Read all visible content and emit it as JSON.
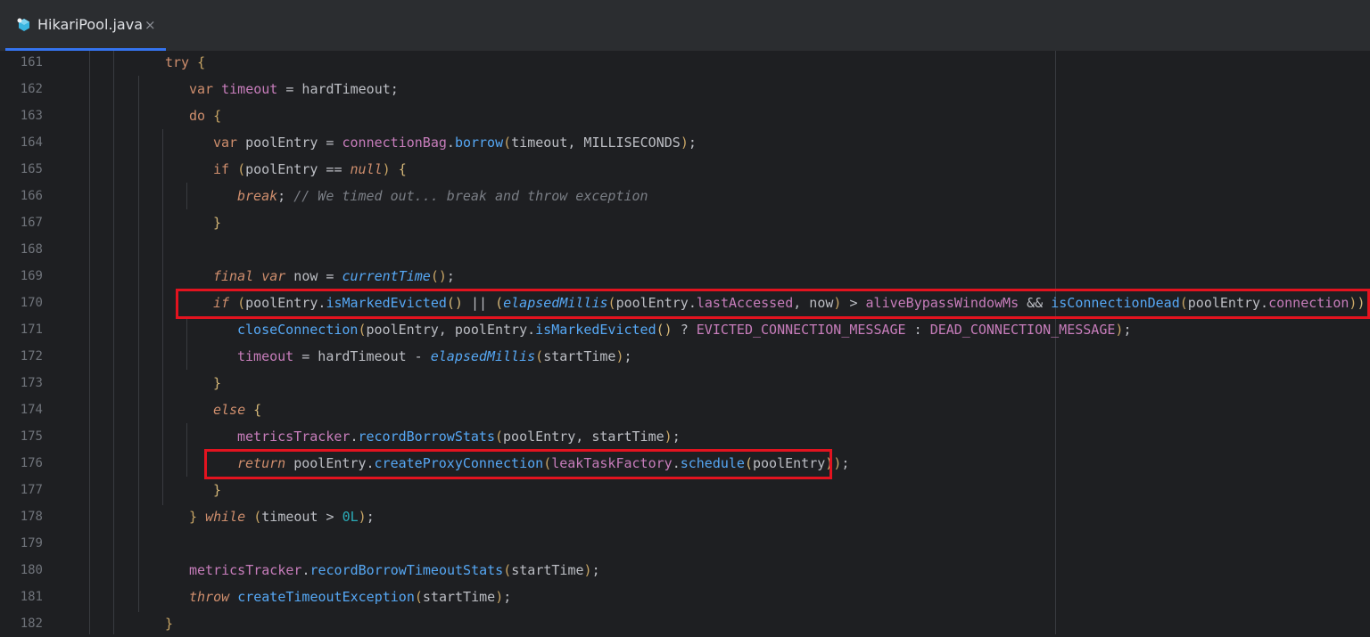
{
  "tab": {
    "label": "HikariPool.java",
    "close": "×",
    "icon": "java-class-icon"
  },
  "highlight_color": "#e3131f",
  "lines": [
    {
      "n": "161",
      "indent": 5,
      "tokens": [
        [
          "kw",
          "try"
        ],
        [
          "var",
          " "
        ],
        [
          "pa",
          "{"
        ]
      ]
    },
    {
      "n": "162",
      "indent": 6,
      "tokens": [
        [
          "kw",
          "var"
        ],
        [
          "var",
          " "
        ],
        [
          "fld",
          "timeout"
        ],
        [
          "var",
          " = hardTimeout;"
        ]
      ]
    },
    {
      "n": "163",
      "indent": 6,
      "tokens": [
        [
          "kw",
          "do"
        ],
        [
          "var",
          " "
        ],
        [
          "pa",
          "{"
        ]
      ]
    },
    {
      "n": "164",
      "indent": 7,
      "tokens": [
        [
          "kw",
          "var"
        ],
        [
          "var",
          " poolEntry = "
        ],
        [
          "fld",
          "connectionBag"
        ],
        [
          "var",
          "."
        ],
        [
          "fn",
          "borrow"
        ],
        [
          "pa",
          "("
        ],
        [
          "var",
          "timeout, MILLISECONDS"
        ],
        [
          "pa",
          ")"
        ],
        [
          "var",
          ";"
        ]
      ]
    },
    {
      "n": "165",
      "indent": 7,
      "tokens": [
        [
          "kw",
          "if"
        ],
        [
          "var",
          " "
        ],
        [
          "pa",
          "("
        ],
        [
          "var",
          "poolEntry == "
        ],
        [
          "kwi",
          "null"
        ],
        [
          "pa",
          ")"
        ],
        [
          "var",
          " "
        ],
        [
          "pb",
          "{"
        ]
      ]
    },
    {
      "n": "166",
      "indent": 8,
      "tokens": [
        [
          "kwi",
          "break"
        ],
        [
          "var",
          "; "
        ],
        [
          "cmt",
          "// We timed out... break and throw exception"
        ]
      ]
    },
    {
      "n": "167",
      "indent": 7,
      "tokens": [
        [
          "pb",
          "}"
        ]
      ]
    },
    {
      "n": "168",
      "indent": 0,
      "tokens": []
    },
    {
      "n": "169",
      "indent": 7,
      "tokens": [
        [
          "kwi",
          "final"
        ],
        [
          "var",
          " "
        ],
        [
          "kwi",
          "var"
        ],
        [
          "var",
          " now = "
        ],
        [
          "sfn",
          "currentTime"
        ],
        [
          "pa",
          "()"
        ],
        [
          "var",
          ";"
        ]
      ]
    },
    {
      "n": "170",
      "indent": 7,
      "tokens": [
        [
          "kwi",
          "if"
        ],
        [
          "var",
          " "
        ],
        [
          "pa",
          "("
        ],
        [
          "var",
          "poolEntry."
        ],
        [
          "fn",
          "isMarkedEvicted"
        ],
        [
          "pb",
          "()"
        ],
        [
          "var",
          " || "
        ],
        [
          "pb",
          "("
        ],
        [
          "sfn",
          "elapsedMillis"
        ],
        [
          "pa",
          "("
        ],
        [
          "var",
          "poolEntry."
        ],
        [
          "fld",
          "lastAccessed"
        ],
        [
          "var",
          ", now"
        ],
        [
          "pa",
          ")"
        ],
        [
          "var",
          " > "
        ],
        [
          "fld",
          "aliveBypassWindowMs"
        ],
        [
          "var",
          " && "
        ],
        [
          "fn",
          "isConnectionDead"
        ],
        [
          "pa",
          "("
        ],
        [
          "var",
          "poolEntry."
        ],
        [
          "fld",
          "connection"
        ],
        [
          "pa",
          ")"
        ],
        [
          "pb",
          ")"
        ],
        [
          "pa",
          ")"
        ],
        [
          "var",
          " "
        ],
        [
          "pb",
          "{"
        ]
      ]
    },
    {
      "n": "171",
      "indent": 8,
      "tokens": [
        [
          "fn",
          "closeConnection"
        ],
        [
          "pa",
          "("
        ],
        [
          "var",
          "poolEntry, poolEntry."
        ],
        [
          "fn",
          "isMarkedEvicted"
        ],
        [
          "pb",
          "()"
        ],
        [
          "var",
          " ? "
        ],
        [
          "cst",
          "EVICTED_CONNECTION_MESSAGE"
        ],
        [
          "var",
          " : "
        ],
        [
          "cst",
          "DEAD_CONNECTION_MESSAGE"
        ],
        [
          "pa",
          ")"
        ],
        [
          "var",
          ";"
        ]
      ]
    },
    {
      "n": "172",
      "indent": 8,
      "tokens": [
        [
          "fld",
          "timeout"
        ],
        [
          "var",
          " = hardTimeout - "
        ],
        [
          "sfn",
          "elapsedMillis"
        ],
        [
          "pa",
          "("
        ],
        [
          "var",
          "startTime"
        ],
        [
          "pa",
          ")"
        ],
        [
          "var",
          ";"
        ]
      ]
    },
    {
      "n": "173",
      "indent": 7,
      "tokens": [
        [
          "pb",
          "}"
        ]
      ]
    },
    {
      "n": "174",
      "indent": 7,
      "tokens": [
        [
          "kwi",
          "else"
        ],
        [
          "var",
          " "
        ],
        [
          "pb",
          "{"
        ]
      ]
    },
    {
      "n": "175",
      "indent": 8,
      "tokens": [
        [
          "fld",
          "metricsTracker"
        ],
        [
          "var",
          "."
        ],
        [
          "fn",
          "recordBorrowStats"
        ],
        [
          "pa",
          "("
        ],
        [
          "var",
          "poolEntry, startTime"
        ],
        [
          "pa",
          ")"
        ],
        [
          "var",
          ";"
        ]
      ]
    },
    {
      "n": "176",
      "indent": 8,
      "tokens": [
        [
          "kwi",
          "return"
        ],
        [
          "var",
          " poolEntry."
        ],
        [
          "fn",
          "createProxyConnection"
        ],
        [
          "pa",
          "("
        ],
        [
          "fld",
          "leakTaskFactory"
        ],
        [
          "var",
          "."
        ],
        [
          "fn",
          "schedule"
        ],
        [
          "pb",
          "("
        ],
        [
          "var",
          "poolEntry"
        ],
        [
          "pb",
          ")"
        ],
        [
          "pa",
          ")"
        ],
        [
          "var",
          ";"
        ]
      ]
    },
    {
      "n": "177",
      "indent": 7,
      "tokens": [
        [
          "pb",
          "}"
        ]
      ]
    },
    {
      "n": "178",
      "indent": 6,
      "tokens": [
        [
          "pa",
          "}"
        ],
        [
          "var",
          " "
        ],
        [
          "kwi",
          "while"
        ],
        [
          "var",
          " "
        ],
        [
          "pa",
          "("
        ],
        [
          "var",
          "timeout > "
        ],
        [
          "num",
          "0L"
        ],
        [
          "pa",
          ")"
        ],
        [
          "var",
          ";"
        ]
      ]
    },
    {
      "n": "179",
      "indent": 0,
      "tokens": []
    },
    {
      "n": "180",
      "indent": 6,
      "tokens": [
        [
          "fld",
          "metricsTracker"
        ],
        [
          "var",
          "."
        ],
        [
          "fn",
          "recordBorrowTimeoutStats"
        ],
        [
          "pa",
          "("
        ],
        [
          "var",
          "startTime"
        ],
        [
          "pa",
          ")"
        ],
        [
          "var",
          ";"
        ]
      ]
    },
    {
      "n": "181",
      "indent": 6,
      "tokens": [
        [
          "kwi",
          "throw"
        ],
        [
          "var",
          " "
        ],
        [
          "fn",
          "createTimeoutException"
        ],
        [
          "pa",
          "("
        ],
        [
          "var",
          "startTime"
        ],
        [
          "pa",
          ")"
        ],
        [
          "var",
          ";"
        ]
      ]
    },
    {
      "n": "182",
      "indent": 5,
      "tokens": [
        [
          "pa",
          "}"
        ]
      ]
    }
  ],
  "highlights": [
    {
      "line": "170",
      "label": "highlight-isConnectionDead-condition"
    },
    {
      "line": "176",
      "label": "highlight-return-proxy-connection"
    }
  ]
}
